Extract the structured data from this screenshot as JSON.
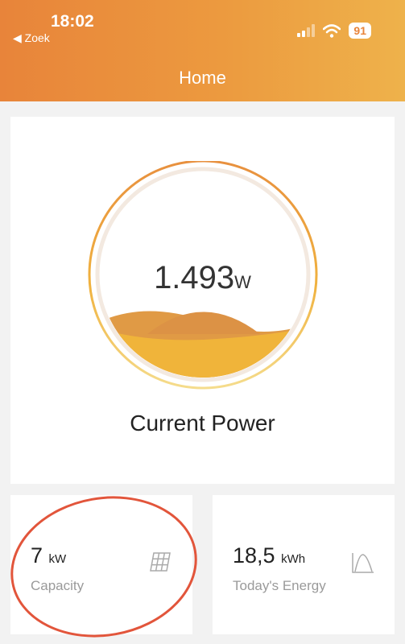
{
  "status_bar": {
    "time": "18:02",
    "back": "◀ Zoek",
    "battery": "91"
  },
  "header": {
    "title": "Home"
  },
  "current_power": {
    "value": "1.493",
    "unit": "W",
    "label": "Current Power"
  },
  "capacity": {
    "value": "7",
    "unit": "kW",
    "label": "Capacity",
    "icon": "solar-panel-icon"
  },
  "energy": {
    "value": "18,5",
    "unit": "kWh",
    "label": "Today's Energy",
    "icon": "curve-chart-icon"
  },
  "colors": {
    "accent": "#e8843a",
    "wave": "#f0b43a",
    "annotation": "#e2553b"
  }
}
